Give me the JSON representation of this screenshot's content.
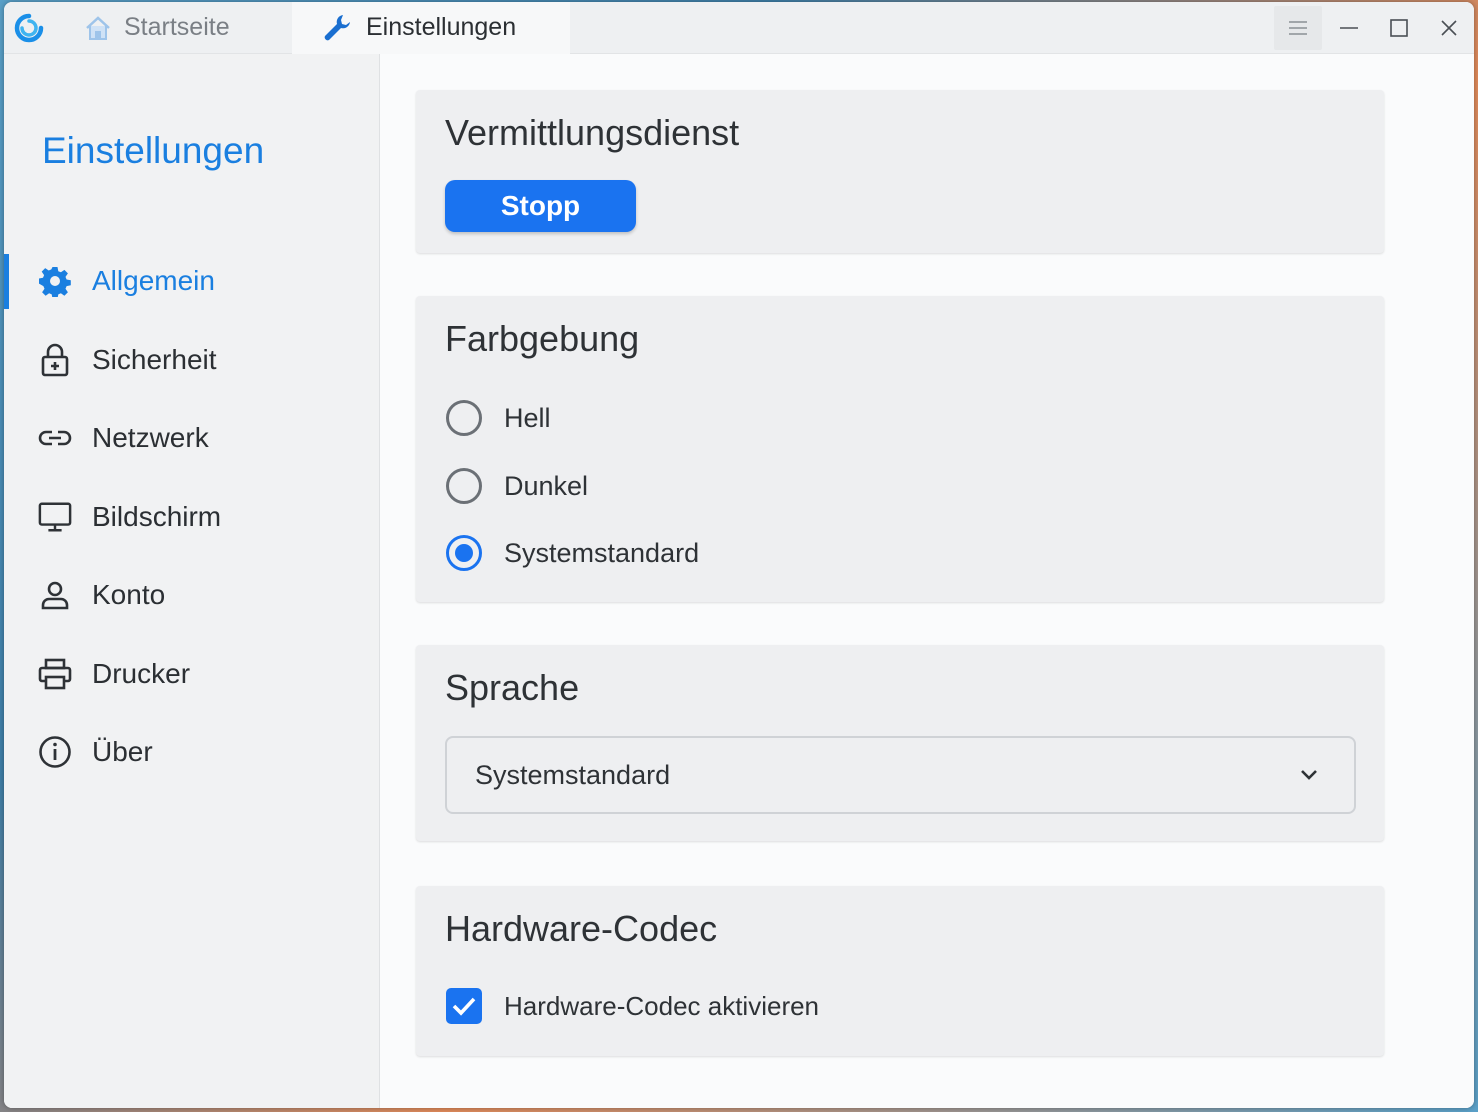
{
  "colors": {
    "accent": "#1a73f0",
    "sidebar_accent": "#1a7fe0"
  },
  "titlebar": {
    "tabs": [
      {
        "label": "Startseite",
        "icon": "home-icon",
        "active": false
      },
      {
        "label": "Einstellungen",
        "icon": "wrench-icon",
        "active": true
      }
    ]
  },
  "sidebar": {
    "title": "Einstellungen",
    "items": [
      {
        "label": "Allgemein",
        "icon": "gear-icon",
        "active": true
      },
      {
        "label": "Sicherheit",
        "icon": "lock-icon"
      },
      {
        "label": "Netzwerk",
        "icon": "link-icon"
      },
      {
        "label": "Bildschirm",
        "icon": "monitor-icon"
      },
      {
        "label": "Konto",
        "icon": "person-icon"
      },
      {
        "label": "Drucker",
        "icon": "printer-icon"
      },
      {
        "label": "Über",
        "icon": "info-icon"
      }
    ]
  },
  "main": {
    "service": {
      "title": "Vermittlungsdienst",
      "button_label": "Stopp"
    },
    "theme": {
      "title": "Farbgebung",
      "options": [
        {
          "label": "Hell",
          "checked": false
        },
        {
          "label": "Dunkel",
          "checked": false
        },
        {
          "label": "Systemstandard",
          "checked": true
        }
      ]
    },
    "language": {
      "title": "Sprache",
      "selected": "Systemstandard"
    },
    "codec": {
      "title": "Hardware-Codec",
      "checkbox_label": "Hardware-Codec aktivieren",
      "checked": true
    }
  }
}
